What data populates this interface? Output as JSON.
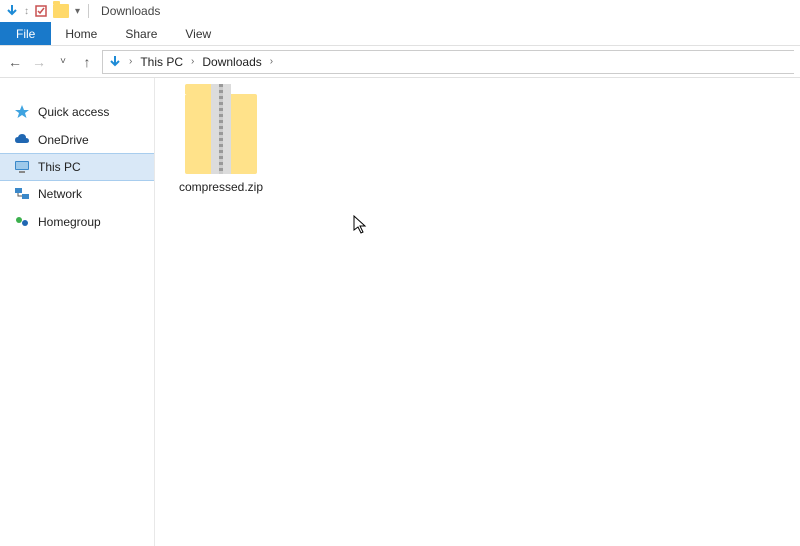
{
  "titlebar": {
    "qat_dropdown": "▾",
    "name": "Downloads"
  },
  "ribbon": {
    "file": "File",
    "tabs": [
      "Home",
      "Share",
      "View"
    ]
  },
  "nav": {
    "back": "←",
    "forward": "→",
    "recent": "˅",
    "up": "↑"
  },
  "address": {
    "crumbs": [
      "This PC",
      "Downloads"
    ]
  },
  "sidebar": {
    "items": [
      {
        "label": "Quick access",
        "icon": "star"
      },
      {
        "label": "OneDrive",
        "icon": "cloud"
      },
      {
        "label": "This PC",
        "icon": "monitor",
        "selected": true
      },
      {
        "label": "Network",
        "icon": "network"
      },
      {
        "label": "Homegroup",
        "icon": "homegroup"
      }
    ]
  },
  "content": {
    "files": [
      {
        "name": "compressed.zip"
      }
    ]
  }
}
